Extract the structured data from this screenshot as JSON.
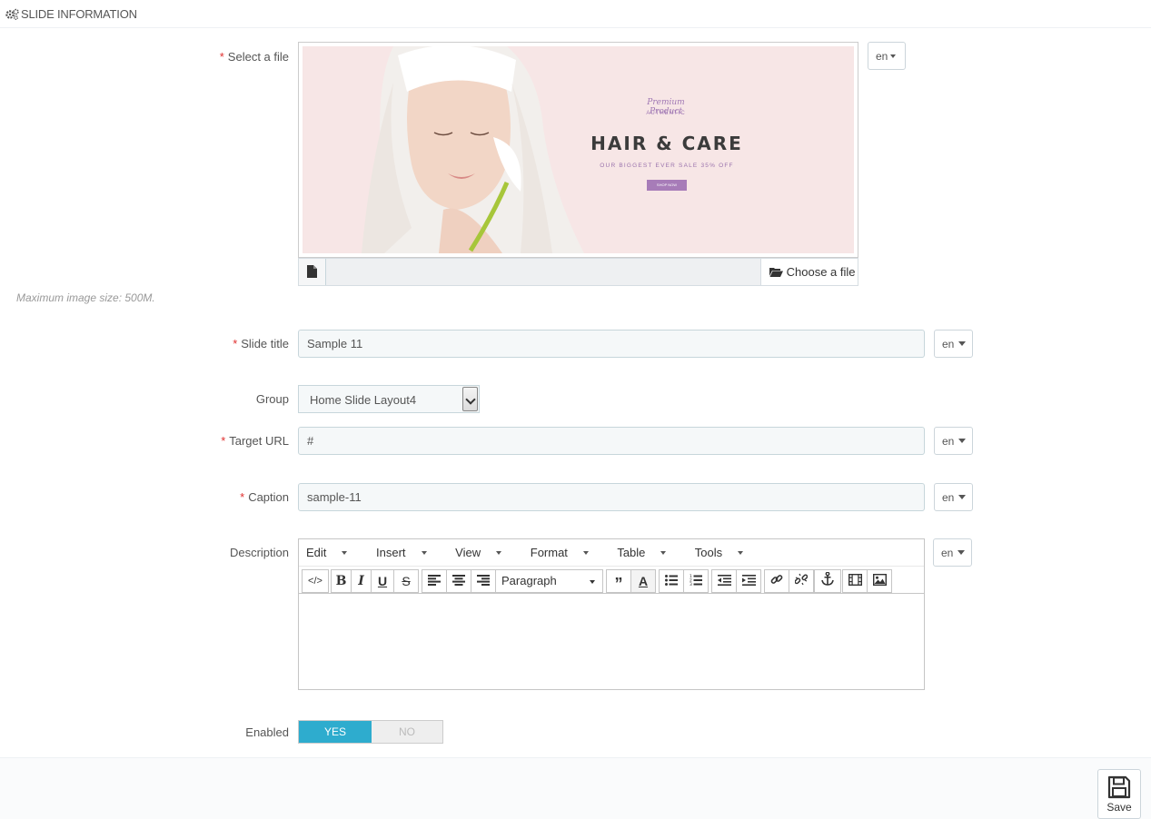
{
  "panel": {
    "title": "SLIDE INFORMATION",
    "icon": "gears-icon"
  },
  "file": {
    "label": "Select a file",
    "choose_label": "Choose a file",
    "hint": "Maximum image size: 500M.",
    "lang": "en",
    "preview": {
      "premium": "Premium Product",
      "authentic": "AUTHENTIC",
      "title": "HAIR & CARE",
      "subtitle": "OUR BIGGEST EVER SALE 35% OFF",
      "button": "SHOP NOW"
    }
  },
  "slide_title": {
    "label": "Slide title",
    "value": "Sample 11",
    "lang": "en"
  },
  "group": {
    "label": "Group",
    "selected": "Home Slide Layout4"
  },
  "target_url": {
    "label": "Target URL",
    "value": "#",
    "lang": "en"
  },
  "caption": {
    "label": "Caption",
    "value": "sample-11",
    "lang": "en"
  },
  "description": {
    "label": "Description",
    "lang": "en",
    "menus": [
      "Edit",
      "Insert",
      "View",
      "Format",
      "Table",
      "Tools"
    ],
    "block_format": "Paragraph",
    "toolbar_icons": [
      "source-code-icon",
      "bold-icon",
      "italic-icon",
      "underline-icon",
      "strikethrough-icon",
      "align-left-icon",
      "align-center-icon",
      "align-right-icon",
      "blockquote-icon",
      "text-color-icon",
      "bullet-list-icon",
      "numbered-list-icon",
      "outdent-icon",
      "indent-icon",
      "link-icon",
      "unlink-icon",
      "anchor-icon",
      "media-icon",
      "image-icon"
    ]
  },
  "enabled": {
    "label": "Enabled",
    "yes": "YES",
    "no": "NO",
    "value": "YES"
  },
  "footer": {
    "save_label": "Save"
  },
  "colors": {
    "accent": "#2eacce",
    "required": "#e0302f",
    "banner_bg": "#f7e6e6"
  }
}
